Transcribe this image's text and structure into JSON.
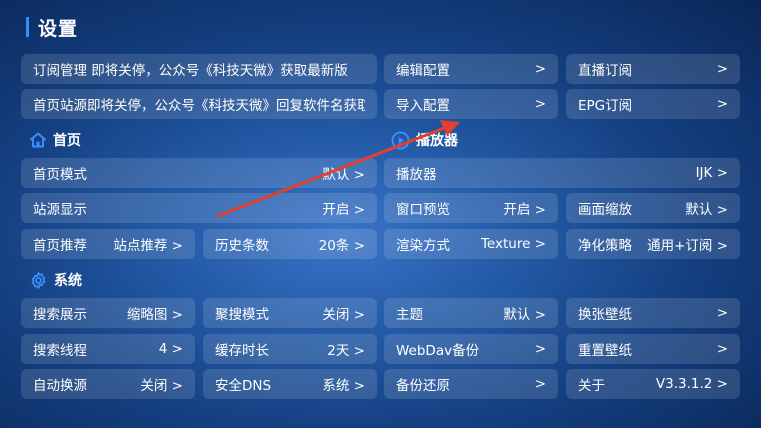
{
  "page": {
    "title": "设置"
  },
  "notices": [
    {
      "text": "订阅管理 即将关停，公众号《科技天微》获取最新版"
    },
    {
      "text": "首页站源即将关停，公众号《科技天微》回复软件名获取"
    }
  ],
  "top_items": {
    "edit_config": {
      "label": "编辑配置",
      "value": ">"
    },
    "live_sub": {
      "label": "直播订阅",
      "value": ">"
    },
    "import_config": {
      "label": "导入配置",
      "value": ">"
    },
    "epg_sub": {
      "label": "EPG订阅",
      "value": ">"
    }
  },
  "sections": {
    "home": {
      "title": "首页",
      "icon": "home-icon"
    },
    "player": {
      "title": "播放器",
      "icon": "play-icon"
    },
    "system": {
      "title": "系统",
      "icon": "gear-icon"
    }
  },
  "home": {
    "mode": {
      "label": "首页模式",
      "value": "默认 >"
    },
    "source_display": {
      "label": "站源显示",
      "value": "开启 >"
    },
    "recommend": {
      "label": "首页推荐",
      "value": "站点推荐 >"
    },
    "history": {
      "label": "历史条数",
      "value": "20条 >"
    }
  },
  "player": {
    "player": {
      "label": "播放器",
      "value": "IJK >"
    },
    "window_preview": {
      "label": "窗口预览",
      "value": "开启 >"
    },
    "scale": {
      "label": "画面缩放",
      "value": "默认 >"
    },
    "render": {
      "label": "渲染方式",
      "value": "Texture >"
    },
    "purify": {
      "label": "净化策略",
      "value": "通用+订阅 >"
    }
  },
  "system": {
    "search_display": {
      "label": "搜索展示",
      "value": "缩略图 >"
    },
    "aggregate_mode": {
      "label": "聚搜模式",
      "value": "关闭 >"
    },
    "theme": {
      "label": "主题",
      "value": "默认 >"
    },
    "change_wallpaper": {
      "label": "换张壁纸",
      "value": ">"
    },
    "search_threads": {
      "label": "搜索线程",
      "value": "4 >"
    },
    "cache_duration": {
      "label": "缓存时长",
      "value": "2天 >"
    },
    "webdav": {
      "label": "WebDav备份",
      "value": ">"
    },
    "reset_wallpaper": {
      "label": "重置壁纸",
      "value": ">"
    },
    "auto_switch": {
      "label": "自动换源",
      "value": "关闭 >"
    },
    "secure_dns": {
      "label": "安全DNS",
      "value": "系统 >"
    },
    "backup_restore": {
      "label": "备份还原",
      "value": ">"
    },
    "about": {
      "label": "关于",
      "value": "V3.3.1.2 >"
    }
  },
  "colors": {
    "accent": "#3c8cff",
    "annotation_arrow": "#e0402f"
  }
}
